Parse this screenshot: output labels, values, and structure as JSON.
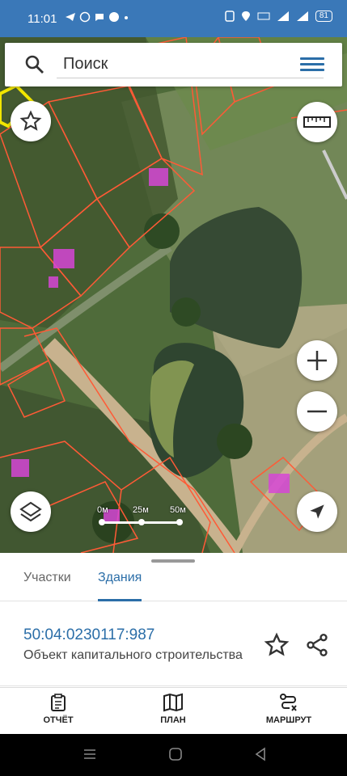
{
  "status_bar": {
    "time": "11:01",
    "left_icons": [
      "telegram-icon",
      "whatsapp-icon",
      "message-icon",
      "app-icon",
      "dot-icon"
    ],
    "right_icons": [
      "nfc-icon",
      "location-icon",
      "volte-icon",
      "signal-icon",
      "4g-icon",
      "battery-icon"
    ],
    "battery": "81"
  },
  "search": {
    "placeholder": "Поиск"
  },
  "map": {
    "scale_labels": [
      "0м",
      "25м",
      "50м"
    ],
    "parcel_color": "#ff5a36",
    "building_color": "#d646d6"
  },
  "tabs": [
    {
      "label": "Участки",
      "active": false
    },
    {
      "label": "Здания",
      "active": true
    }
  ],
  "object": {
    "cadastral_number": "50:04:0230117:987",
    "description": "Объект капитального строительства"
  },
  "bottom_nav": {
    "report": "ОТЧЁТ",
    "plan": "ПЛАН",
    "route": "МАРШРУТ"
  },
  "colors": {
    "accent": "#2b6ea8",
    "status_bar": "#3a78b8"
  }
}
